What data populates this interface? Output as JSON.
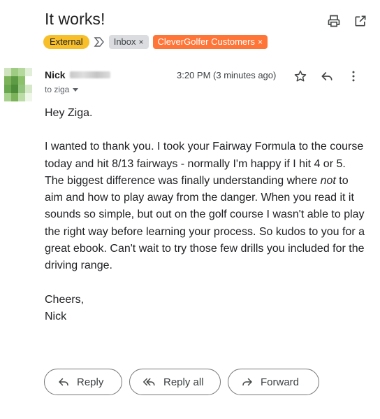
{
  "email": {
    "subject": "It works!",
    "labels": {
      "external": "External",
      "inbox": "Inbox",
      "clever": "CleverGolfer Customers",
      "remove_symbol": "×"
    },
    "sender": {
      "name": "Nick",
      "to": "to ziga"
    },
    "timestamp": "3:20 PM (3 minutes ago)",
    "body": {
      "greeting": "Hey Ziga.",
      "p1_before": "I wanted to thank you. I took your Fairway Formula to the course today and hit 8/13 fairways - normally I'm happy if I hit 4 or 5. The biggest difference was finally understanding where ",
      "p1_em": "not",
      "p1_after": " to aim and how to play away from the danger. When you read it it sounds so simple, but out on the golf course I wasn't able to play the right way before learning your process. So kudos to you for a great ebook. Can't wait to try those few drills you included for the driving range.",
      "signoff": "Cheers,",
      "signature": "Nick"
    }
  },
  "actions": {
    "reply": "Reply",
    "reply_all": "Reply all",
    "forward": "Forward"
  },
  "icons": {
    "print": "print-icon",
    "open_new_window": "open-in-new-icon",
    "star": "star-icon",
    "reply": "reply-icon",
    "more": "more-vert-icon",
    "label_arrow": "label-arrow-icon",
    "dropdown": "dropdown-icon"
  },
  "colors": {
    "external_chip": "#f7bf2a",
    "inbox_chip": "#dadce0",
    "clever_chip": "#ff7537",
    "avatar_green": "#7cb35a"
  }
}
